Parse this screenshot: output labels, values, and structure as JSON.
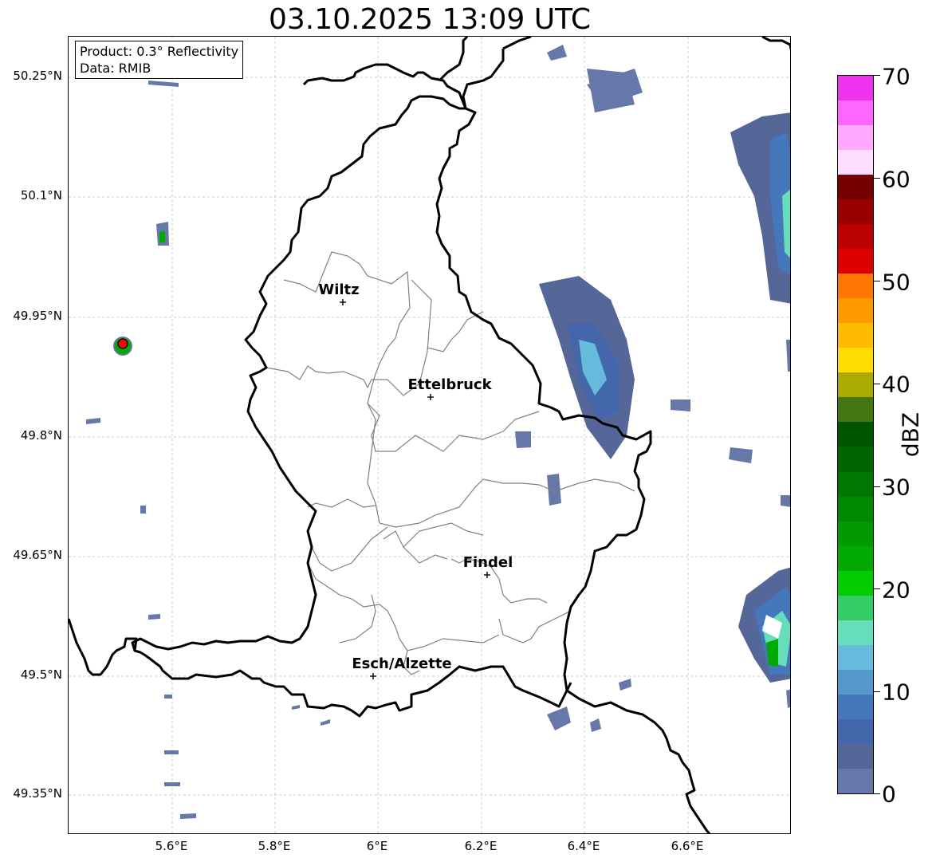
{
  "title": "03.10.2025 13:09 UTC",
  "info_box": {
    "product": "Product: 0.3° Reflectivity",
    "data_source": "Data: RMIB"
  },
  "lat_labels": [
    "50.25°N",
    "50.1°N",
    "49.95°N",
    "49.8°N",
    "49.65°N",
    "49.5°N",
    "49.35°N"
  ],
  "lon_labels": [
    "5.6°E",
    "5.8°E",
    "6°E",
    "6.2°E",
    "6.4°E",
    "6.6°E"
  ],
  "colorbar": {
    "label": "dBZ",
    "ticks": [
      "70",
      "60",
      "50",
      "40",
      "30",
      "20",
      "10",
      "0"
    ],
    "colors_top_to_bottom": [
      "#ee33ee",
      "#ff66ff",
      "#ffaaff",
      "#ffddff",
      "#770000",
      "#990000",
      "#bb0000",
      "#dd0000",
      "#ff7700",
      "#ff9900",
      "#ffbb00",
      "#ffdd00",
      "#aaaa00",
      "#447711",
      "#005500",
      "#006600",
      "#007700",
      "#008800",
      "#009900",
      "#00aa00",
      "#00cc00",
      "#33cc66",
      "#66ddbb",
      "#66bbdd",
      "#5599cc",
      "#4477bb",
      "#4466aa",
      "#556699",
      "#6677aa"
    ]
  },
  "cities": [
    {
      "name": "Wiltz"
    },
    {
      "name": "Ettelbruck"
    },
    {
      "name": "Findel"
    },
    {
      "name": "Esch/Alzette"
    }
  ],
  "radar_site_color": "#ff0000",
  "border_color": "#000000",
  "canton_color": "#808080"
}
